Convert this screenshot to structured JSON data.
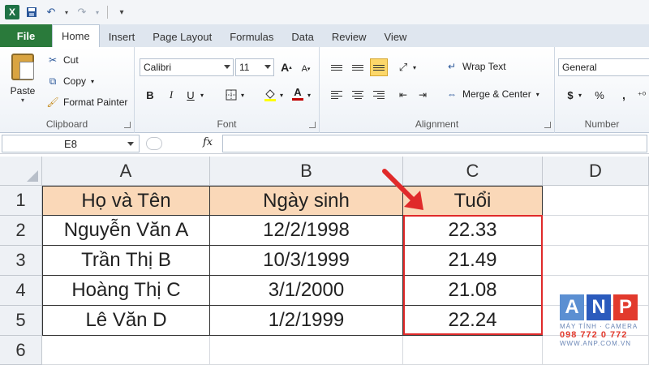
{
  "qat": {
    "icons": [
      "excel-logo-icon",
      "save-icon",
      "undo-icon",
      "redo-icon",
      "customize-icon"
    ],
    "excel_glyph": "X"
  },
  "tabs": [
    "File",
    "Home",
    "Insert",
    "Page Layout",
    "Formulas",
    "Data",
    "Review",
    "View"
  ],
  "clipboard": {
    "paste": "Paste",
    "cut": "Cut",
    "copy": "Copy",
    "format_painter": "Format Painter",
    "label": "Clipboard"
  },
  "font": {
    "name": "Calibri",
    "size": "11",
    "grow": "A",
    "shrink": "A",
    "bold": "B",
    "italic": "I",
    "underline": "U",
    "font_color_glyph": "A",
    "font_color": "#c00000",
    "label": "Font"
  },
  "alignment": {
    "wrap_text": "Wrap Text",
    "merge_center": "Merge & Center",
    "label": "Alignment"
  },
  "number": {
    "format": "General",
    "currency": "$",
    "percent": "%",
    "label": "Number"
  },
  "formula_bar": {
    "name_box": "E8",
    "fx": "fx",
    "formula": ""
  },
  "sheet": {
    "columns": [
      "A",
      "B",
      "C",
      "D"
    ],
    "rows": [
      "1",
      "2",
      "3",
      "4",
      "5",
      "6"
    ],
    "data": [
      [
        "Họ và Tên",
        "Ngày sinh",
        "Tuổi"
      ],
      [
        "Nguyễn Văn A",
        "12/2/1998",
        "22.33"
      ],
      [
        "Trần Thị B",
        "10/3/1999",
        "21.49"
      ],
      [
        "Hoàng Thị C",
        "3/1/2000",
        "21.08"
      ],
      [
        "Lê Văn D",
        "1/2/1999",
        "22.24"
      ]
    ],
    "header_fill": "#fad8b8",
    "highlight_color": "#e02a2a"
  },
  "watermark": {
    "letters": [
      "A",
      "N",
      "P"
    ],
    "tagline": "MÁY TÍNH · CAMERA",
    "phone": "098 772 0 772",
    "site": "WWW.ANP.COM.VN"
  }
}
